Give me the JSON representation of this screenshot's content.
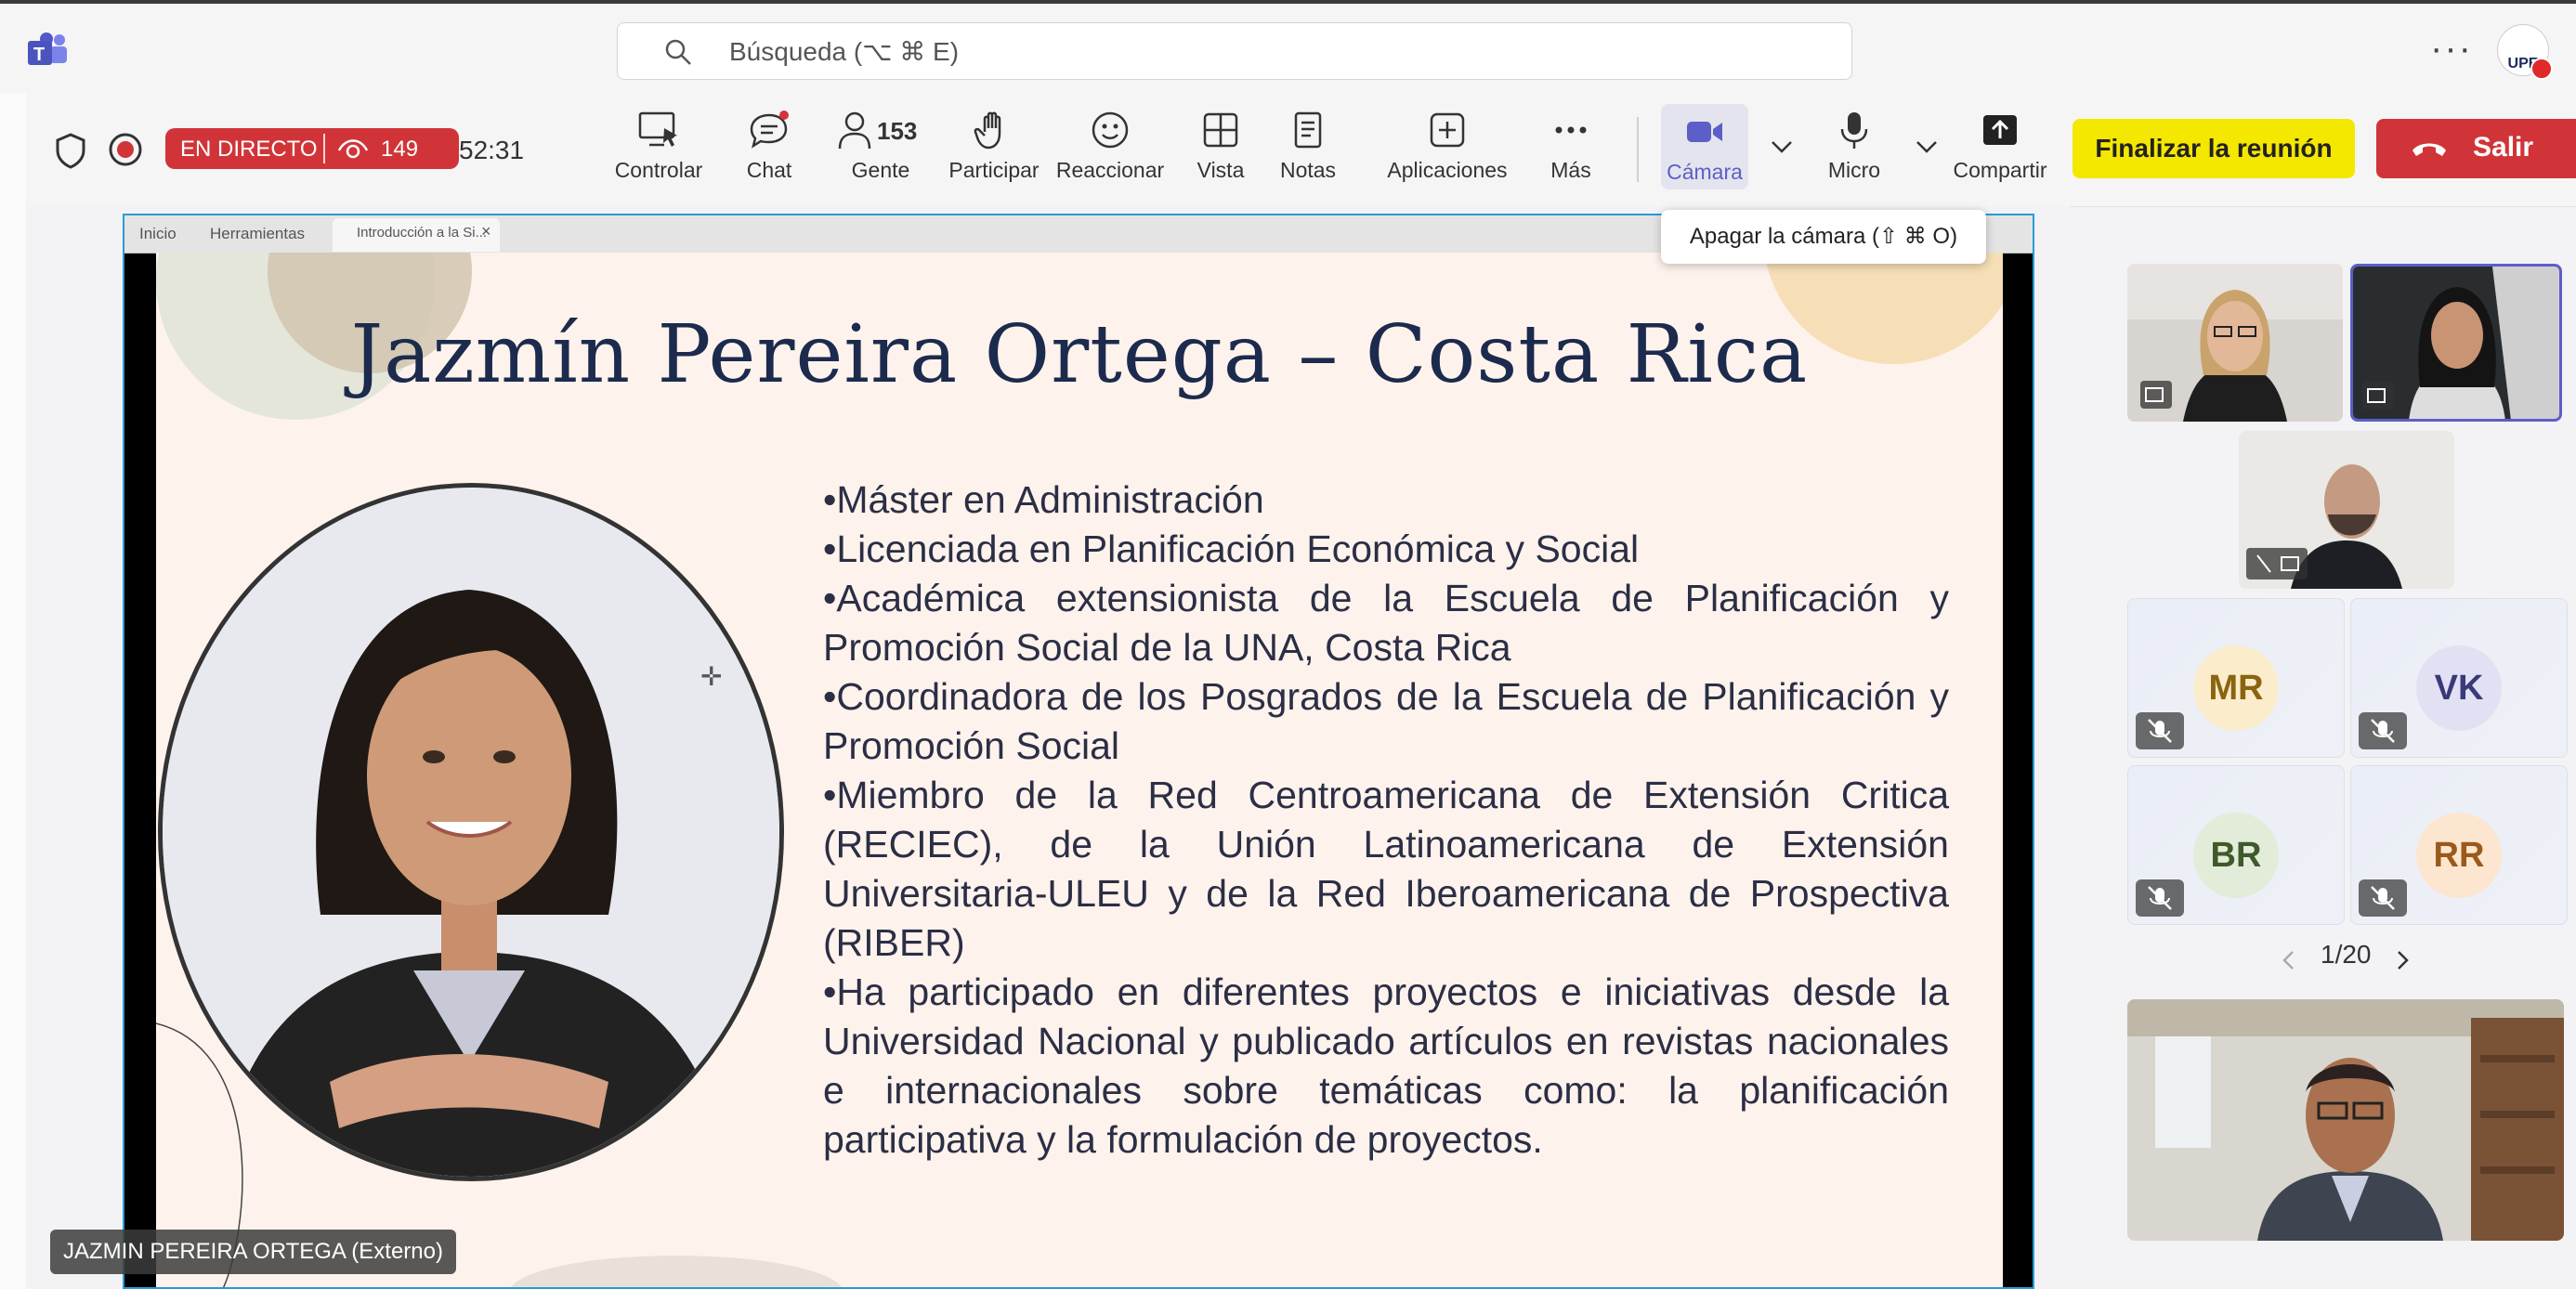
{
  "titlebar": {
    "search_placeholder": "Búsqueda (⌥ ⌘ E)",
    "more": "···",
    "avatar_initials": "UPE"
  },
  "toolbar": {
    "live_label": "EN DIRECTO",
    "viewers": "149",
    "timer": "52:31",
    "items": [
      {
        "label": "Controlar",
        "icon": "share-control-icon"
      },
      {
        "label": "Chat",
        "icon": "chat-icon"
      },
      {
        "label": "Gente",
        "icon": "people-icon",
        "count": "153"
      },
      {
        "label": "Participar",
        "icon": "raise-hand-icon"
      },
      {
        "label": "Reaccionar",
        "icon": "smile-icon"
      },
      {
        "label": "Vista",
        "icon": "grid-view-icon"
      },
      {
        "label": "Notas",
        "icon": "notes-icon"
      },
      {
        "label": "Aplicaciones",
        "icon": "plus-square-icon"
      },
      {
        "label": "Más",
        "icon": "more-icon"
      },
      {
        "label": "Cámara",
        "icon": "camera-icon"
      },
      {
        "label": "Micro",
        "icon": "mic-icon"
      },
      {
        "label": "Compartir",
        "icon": "share-up-icon"
      }
    ],
    "end_meeting": "Finalizar la reunión",
    "leave": "Salir",
    "tooltip": "Apagar la cámara (⇧ ⌘ O)"
  },
  "browser_tabs": [
    "Inicio",
    "Herramientas",
    "Introducción a la Si...",
    "×"
  ],
  "slide": {
    "title": "Jazmín Pereira Ortega – Costa Rica",
    "bullets": [
      "•Máster en Administración",
      "•Licenciada en Planificación Económica y Social",
      "•Académica extensionista de la Escuela de Planificación y Promoción Social de la UNA, Costa Rica",
      "•Coordinadora de los Posgrados de la Escuela de Planificación y Promoción Social",
      "•Miembro de la Red Centroamericana de Extensión Critica (RECIEC), de la Unión Latinoamericana de Extensión Universitaria-ULEU y de la Red Iberoamericana de Prospectiva (RIBER)",
      "•Ha participado en diferentes proyectos e iniciativas desde la Universidad Nacional y publicado artículos en revistas nacionales e internacionales sobre temáticas como: la planificación participativa y la formulación de proyectos."
    ]
  },
  "speaker_label": "JAZMIN PEREIRA ORTEGA (Externo)",
  "participants": {
    "initials": [
      {
        "text": "MR",
        "bg": "#fbeccc",
        "fg": "#8a6410"
      },
      {
        "text": "VK",
        "bg": "#e2e1f4",
        "fg": "#3b3a78"
      },
      {
        "text": "BR",
        "bg": "#e3ecd9",
        "fg": "#3f5a2a"
      },
      {
        "text": "RR",
        "bg": "#fde6cf",
        "fg": "#9a5a1c"
      }
    ],
    "pager": "1/20"
  },
  "colors": {
    "accent": "#5b5fc7",
    "live_red": "#d13438",
    "end_yellow": "#f4e700",
    "slide_title": "#1c2a4d"
  }
}
